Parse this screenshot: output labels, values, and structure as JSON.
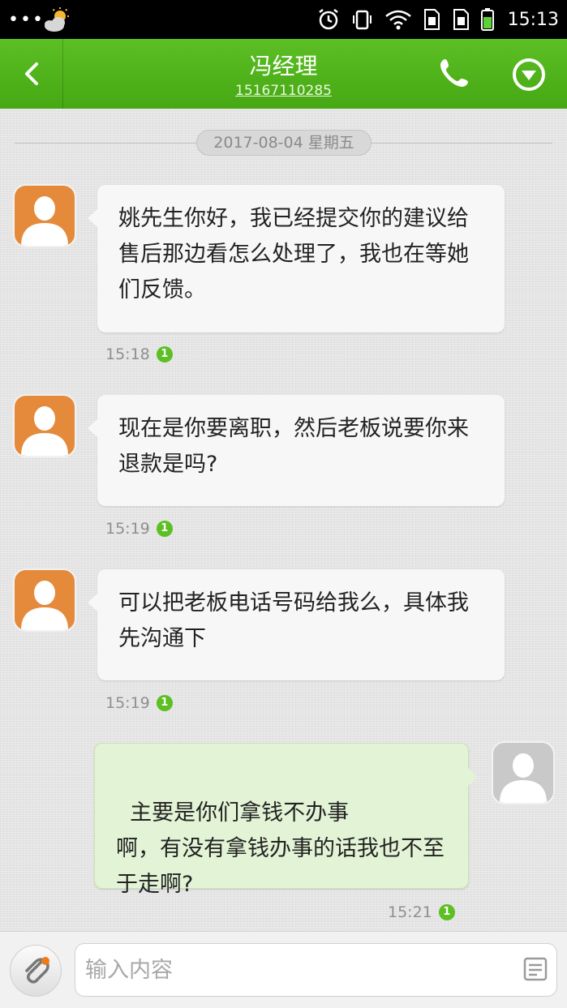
{
  "status_bar": {
    "dots": "•••",
    "time": "15:13"
  },
  "header": {
    "contact_name": "冯经理",
    "contact_phone": "15167110285"
  },
  "date_separator": "2017-08-04  星期五",
  "messages": [
    {
      "direction": "incoming",
      "text": "姚先生你好，我已经提交你的建议给售后那边看怎么处理了，我也在等她们反馈。",
      "time": "15:18",
      "sim": "1"
    },
    {
      "direction": "incoming",
      "text": "现在是你要离职，然后老板说要你来退款是吗?",
      "time": "15:19",
      "sim": "1"
    },
    {
      "direction": "incoming",
      "text": "可以把老板电话号码给我么，具体我先沟通下",
      "time": "15:19",
      "sim": "1"
    },
    {
      "direction": "outgoing",
      "text": "主要是你们拿钱不办事\n啊，有没有拿钱办事的话我也不至于走啊?",
      "time": "15:21",
      "sim": "1"
    }
  ],
  "input": {
    "placeholder": "输入内容",
    "value": ""
  },
  "colors": {
    "header_green": "#4caf1a",
    "incoming_avatar": "#e58a3b",
    "outgoing_bubble": "#e3f4d6"
  },
  "icons": [
    "weather-icon",
    "alarm-icon",
    "vibrate-icon",
    "wifi-icon",
    "sim1-icon",
    "sim2-icon",
    "battery-icon",
    "back-icon",
    "phone-icon",
    "dropdown-icon",
    "paperclip-icon",
    "template-icon"
  ]
}
